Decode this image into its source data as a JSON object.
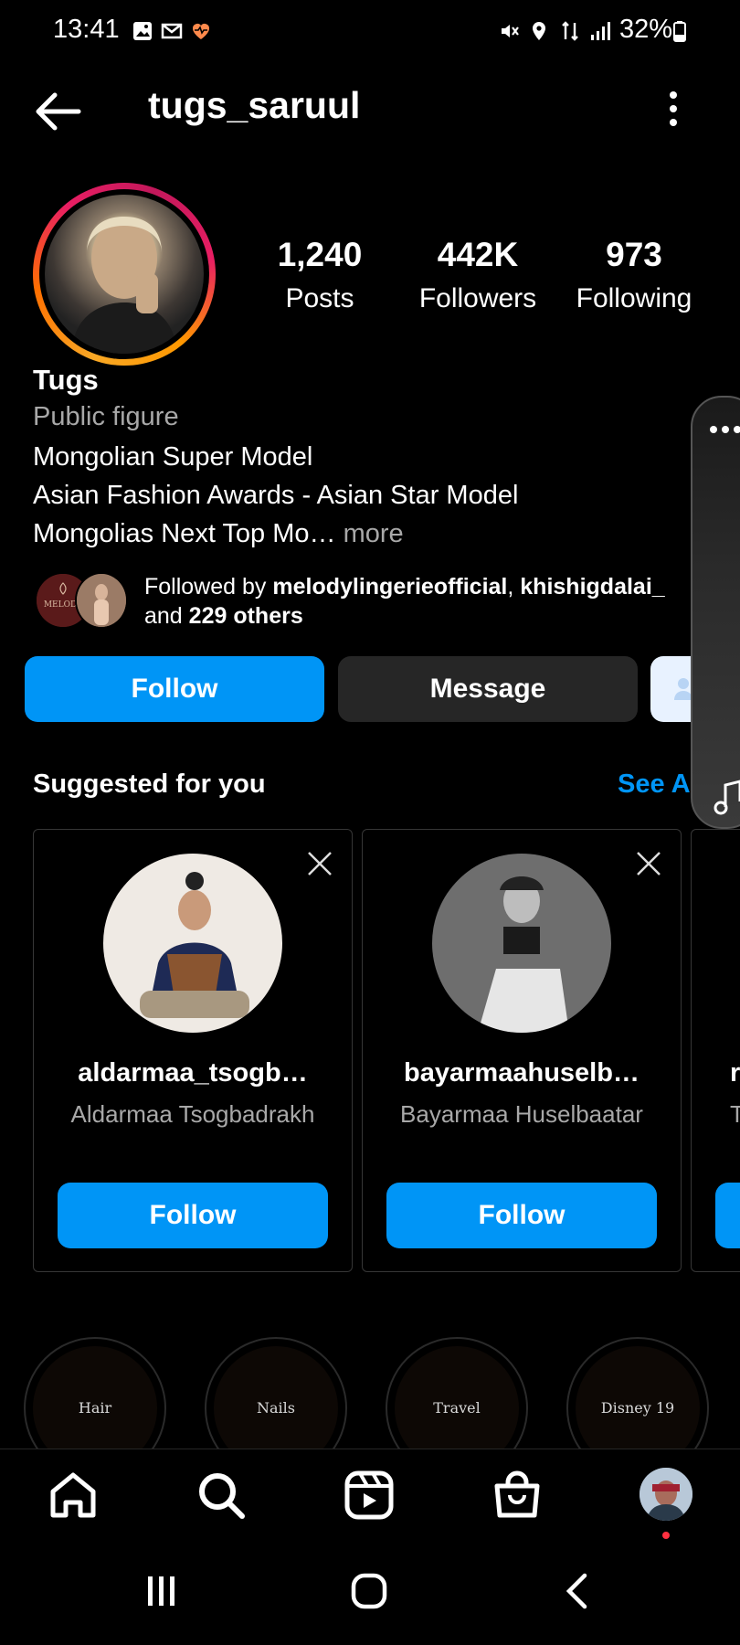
{
  "status_bar": {
    "time": "13:41",
    "battery": "32%",
    "left_icons": [
      "gallery-icon",
      "gmail-icon",
      "health-icon"
    ],
    "right_icons": [
      "mute-icon",
      "location-icon",
      "data-icon",
      "signal-icon",
      "battery-icon"
    ]
  },
  "header": {
    "username": "tugs_saruul",
    "back_icon": "arrow-left-icon",
    "menu_icon": "more-vertical-icon"
  },
  "profile": {
    "stats": [
      {
        "value": "1,240",
        "label": "Posts"
      },
      {
        "value": "442K",
        "label": "Followers"
      },
      {
        "value": "973",
        "label": "Following"
      }
    ],
    "name": "Tugs",
    "category": "Public figure",
    "bio_lines": [
      "Mongolian Super Model",
      "Asian Fashion Awards - Asian Star Model",
      "Mongolias Next Top Mo…"
    ],
    "bio_more": " more",
    "followed_by": {
      "prefix": "Followed by ",
      "user1": "melodylingerieofficial",
      "sep": ", ",
      "user2": "khishigdalai_",
      "and": "and ",
      "others": "229 others",
      "avatar1_text": "MELODY"
    }
  },
  "actions": {
    "follow": "Follow",
    "message": "Message"
  },
  "suggested": {
    "title": "Suggested for you",
    "see_all": "See A",
    "cards": [
      {
        "username": "aldarmaa_tsogb…",
        "full_name": "Aldarmaa Tsogbadrakh",
        "button": "Follow"
      },
      {
        "username": "bayarmaahuselb…",
        "full_name": "Bayarmaa Huselbaatar",
        "button": "Follow"
      },
      {
        "username": "r",
        "full_name": "T",
        "button": ""
      }
    ]
  },
  "highlights": [
    "Hair",
    "Nails",
    "Travel",
    "Disney 19"
  ],
  "bottom_nav": [
    "home-icon",
    "search-icon",
    "reels-icon",
    "shop-icon",
    "profile-avatar"
  ],
  "system_nav": [
    "recents-icon",
    "home-circle-icon",
    "back-icon"
  ],
  "colors": {
    "accent": "#0095f6",
    "background": "#000000",
    "secondary_button": "#262626",
    "muted_text": "#a8a8a8"
  }
}
